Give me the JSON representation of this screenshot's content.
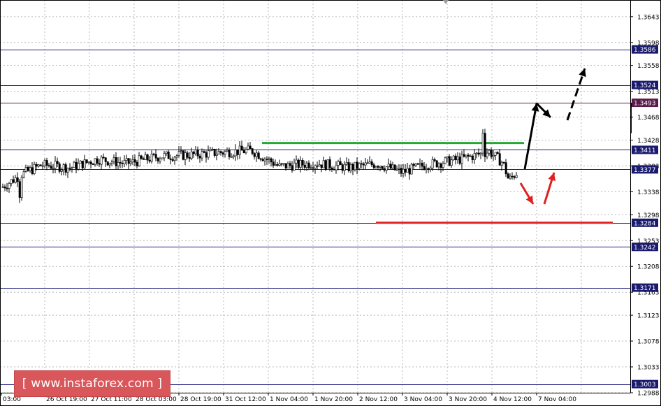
{
  "chart_data": {
    "type": "candlestick",
    "y_axis": {
      "range": [
        1.2988,
        1.3672
      ],
      "ticks": [
        "1.3643",
        "1.3598",
        "1.3558",
        "1.3513",
        "1.3468",
        "1.3428",
        "1.3383",
        "1.3338",
        "1.3298",
        "1.3253",
        "1.3208",
        "1.3163",
        "1.3123",
        "1.3078",
        "1.3033",
        "1.2988"
      ]
    },
    "x_axis": {
      "ticks": [
        "03:00",
        "26 Oct 19:00",
        "27 Oct 11:00",
        "28 Oct 03:00",
        "28 Oct 19:00",
        "31 Oct 12:00",
        "1 Nov 04:00",
        "1 Nov 20:00",
        "2 Nov 12:00",
        "3 Nov 04:00",
        "3 Nov 20:00",
        "4 Nov 12:00",
        "7 Nov 04:00"
      ]
    },
    "levels": [
      {
        "label": "1.3586",
        "value": 1.3586,
        "color": "#1a1a7a"
      },
      {
        "label": "1.3524",
        "value": 1.3524,
        "color": "#1a1a7a"
      },
      {
        "label": "1.3493",
        "value": 1.3493,
        "color": "#5a1a4a"
      },
      {
        "label": "1.3411",
        "value": 1.3411,
        "color": "#1a1a7a"
      },
      {
        "label": "1.3377",
        "value": 1.3377,
        "color": "#1a1a7a"
      },
      {
        "label": "1.3284",
        "value": 1.3284,
        "color": "#1a1a7a"
      },
      {
        "label": "1.3242",
        "value": 1.3242,
        "color": "#1a1a7a"
      },
      {
        "label": "1.3171",
        "value": 1.3171,
        "color": "#1a1a7a"
      },
      {
        "label": "1.3003",
        "value": 1.3003,
        "color": "#1a1a7a"
      }
    ],
    "current_price_label": "1.3377",
    "resistance_zone": {
      "value": 1.3423,
      "color": "#22aa33"
    },
    "support_zone": {
      "value": 1.3284,
      "color": "#e02020"
    },
    "colors": {
      "grid": "#b8b8b8",
      "axis": "#000000",
      "candle": "#000000",
      "level_label_bg": "#1a1a6e",
      "highlight_label_bg": "#5a1a4a",
      "forecast_up": "#000000",
      "forecast_down": "#e02020"
    }
  },
  "watermark": {
    "text": "[ www.instaforex.com ]",
    "color": "#d9575b"
  }
}
